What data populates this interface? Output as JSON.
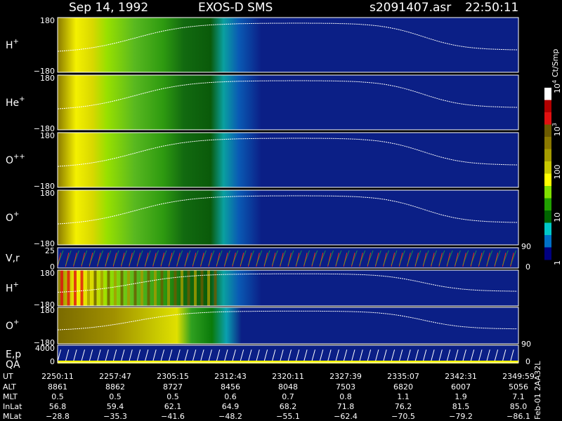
{
  "header": {
    "date": "Sep 14, 1992",
    "mission": "EXOS-D SMS",
    "file": "s2091407.asr",
    "time": "22:50:11"
  },
  "colors": {
    "background": "#000000",
    "plot_background": "#0b1f86",
    "trace": "#ffffff",
    "energy_trace": "#ff2020",
    "velocity_trace": "#20e020"
  },
  "chart_data": {
    "type": "heatmap",
    "panels": [
      {
        "species": "H",
        "charge": "+",
        "yticks": [
          "180",
          "−180"
        ],
        "ylim": [
          -180,
          180
        ],
        "sample": "H+ angle-time spectrogram"
      },
      {
        "species": "He",
        "charge": "+",
        "yticks": [
          "180",
          "−180"
        ],
        "ylim": [
          -180,
          180
        ]
      },
      {
        "species": "O",
        "charge": "++",
        "yticks": [
          "180",
          "−180"
        ],
        "ylim": [
          -180,
          180
        ]
      },
      {
        "species": "O",
        "charge": "+",
        "yticks": [
          "180",
          "−180"
        ],
        "ylim": [
          -180,
          180
        ]
      },
      {
        "species": "V,r",
        "charge": "",
        "yticks": [
          "25",
          "0"
        ],
        "ylim": [
          0,
          25
        ],
        "right_ticks": [
          "90",
          "0"
        ]
      },
      {
        "species": "H",
        "charge": "+",
        "yticks": [
          "180",
          "−180"
        ],
        "ylim": [
          -180,
          180
        ]
      },
      {
        "species": "O",
        "charge": "+",
        "yticks": [
          "180",
          "−180"
        ],
        "ylim": [
          -180,
          180
        ]
      },
      {
        "species": "E,p",
        "charge": "",
        "second_label": "QA",
        "yticks": [
          "4000",
          "0"
        ],
        "ylim": [
          0,
          4000
        ],
        "right_ticks": [
          "90",
          "0"
        ]
      }
    ],
    "colorbar": {
      "label": "Ct/Smp",
      "scale": "log",
      "range": [
        1,
        10000
      ],
      "ticks": [
        {
          "text": "10",
          "sup": "4"
        },
        {
          "text": "10",
          "sup": "3"
        },
        {
          "text": "100",
          "sup": ""
        },
        {
          "text": "10",
          "sup": ""
        },
        {
          "text": "1",
          "sup": ""
        }
      ],
      "colors": [
        "#ffffff",
        "#b00000",
        "#e01010",
        "#6b5a00",
        "#8a7800",
        "#a59b00",
        "#c8c800",
        "#ffff00",
        "#80e000",
        "#20a000",
        "#006400",
        "#00c8c8",
        "#0070c8",
        "#000080"
      ]
    },
    "time_table": {
      "row_labels": [
        "UT",
        "ALT",
        "MLT",
        "InLat",
        "MLat"
      ],
      "columns": [
        [
          "2250:11",
          "8861",
          "0.5",
          "56.8",
          "−28.8"
        ],
        [
          "2257:47",
          "8862",
          "0.5",
          "59.4",
          "−35.3"
        ],
        [
          "2305:15",
          "8727",
          "0.5",
          "62.1",
          "−41.6"
        ],
        [
          "2312:43",
          "8456",
          "0.6",
          "64.9",
          "−48.2"
        ],
        [
          "2320:11",
          "8048",
          "0.7",
          "68.2",
          "−55.1"
        ],
        [
          "2327:39",
          "7503",
          "0.8",
          "71.8",
          "−62.4"
        ],
        [
          "2335:07",
          "6820",
          "1.1",
          "76.2",
          "−70.5"
        ],
        [
          "2342:31",
          "6007",
          "1.9",
          "81.5",
          "−79.2"
        ],
        [
          "2349:59",
          "5056",
          "7.1",
          "85.0",
          "−86.1"
        ]
      ]
    },
    "side_label": "Feb-01 2AA32L"
  }
}
